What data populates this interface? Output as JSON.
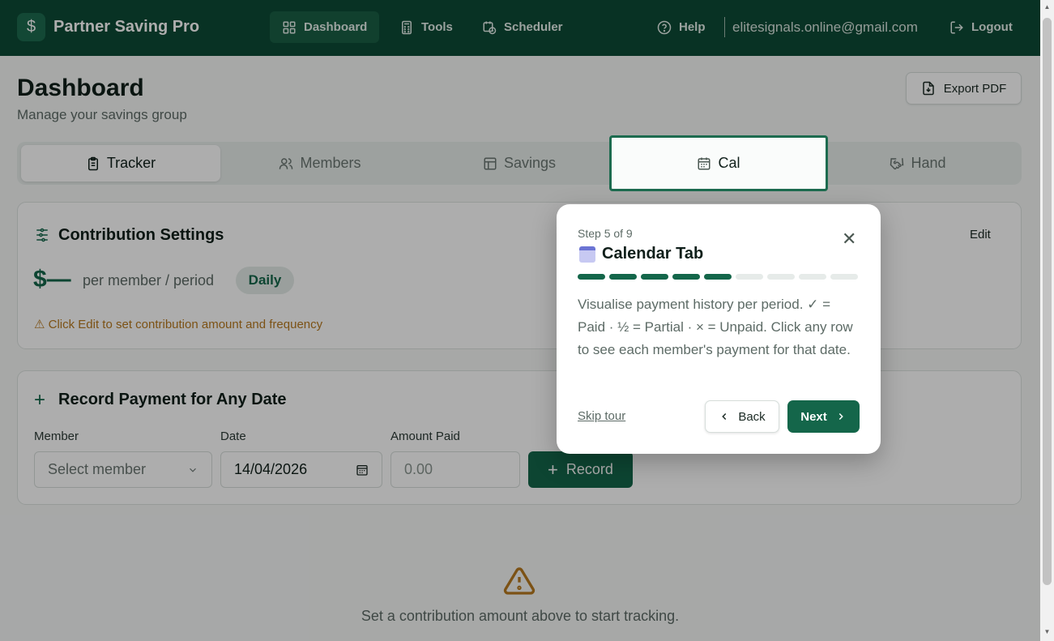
{
  "app": {
    "brand": "Partner Saving Pro",
    "brand_icon": "dollar-icon",
    "nav": [
      {
        "label": "Dashboard",
        "icon": "grid-icon",
        "active": true
      },
      {
        "label": "Tools",
        "icon": "calculator-icon",
        "active": false
      },
      {
        "label": "Scheduler",
        "icon": "calendar-clock-icon",
        "active": false
      }
    ],
    "help_label": "Help",
    "email": "elitesignals.online@gmail.com",
    "logout_label": "Logout"
  },
  "page": {
    "title": "Dashboard",
    "subtitle": "Manage your savings group",
    "export_label": "Export PDF"
  },
  "tabs": [
    {
      "label": "Tracker",
      "icon": "clipboard-icon"
    },
    {
      "label": "Members",
      "icon": "users-icon"
    },
    {
      "label": "Savings",
      "icon": "table-icon"
    },
    {
      "label": "Cal",
      "icon": "calendar-icon"
    },
    {
      "label": "Hand",
      "icon": "handshake-icon"
    }
  ],
  "contribution": {
    "title": "Contribution Settings",
    "edit_label": "Edit",
    "amount": "$—",
    "per_label": "per member / period",
    "frequency": "Daily",
    "warning": "⚠ Click Edit to set contribution amount and frequency"
  },
  "record": {
    "title": "Record Payment for Any Date",
    "member_label": "Member",
    "member_placeholder": "Select member",
    "date_label": "Date",
    "date_value": "14/04/2026",
    "amount_label": "Amount Paid",
    "amount_placeholder": "0.00",
    "record_label": "Record"
  },
  "empty_state": {
    "text": "Set a contribution amount above to start tracking."
  },
  "tour": {
    "step": "Step 5 of 9",
    "title": "Calendar Tab",
    "current_step": 5,
    "total_steps": 9,
    "body": "Visualise payment history per period. ✓ = Paid · ½ = Partial · × = Unpaid. Click any row to see each member's payment for that date.",
    "skip_label": "Skip tour",
    "back_label": "Back",
    "next_label": "Next"
  },
  "colors": {
    "brand": "#0d4a35",
    "accent": "#14664a",
    "warning": "#b7791f"
  }
}
